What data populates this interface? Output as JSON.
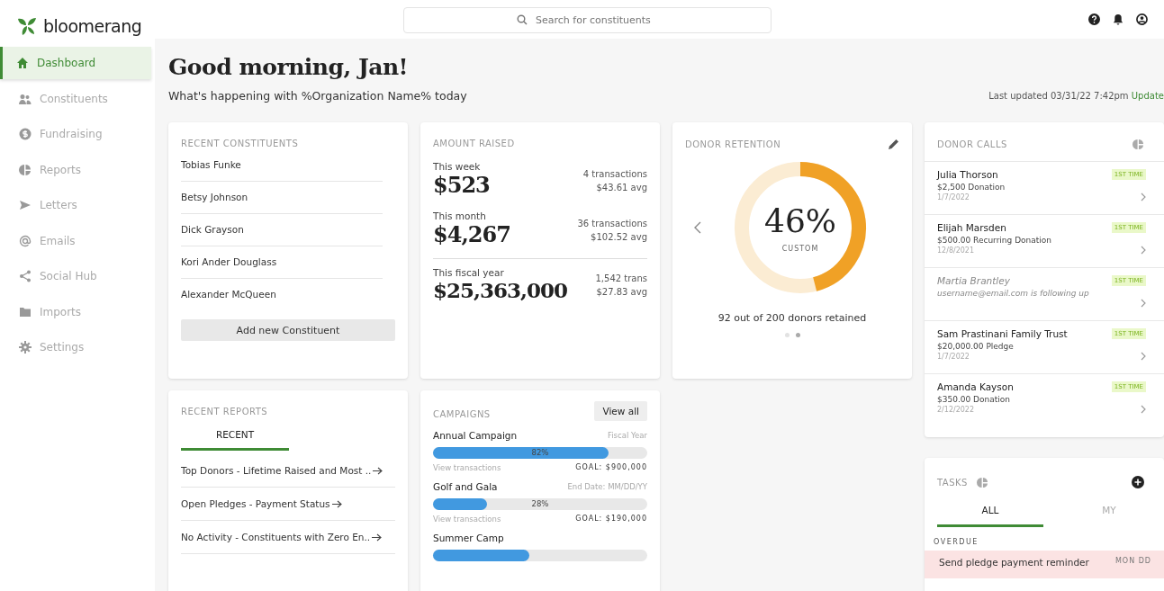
{
  "brand": "bloomerang",
  "search": {
    "placeholder": "Search for constituents"
  },
  "nav": [
    {
      "label": "Dashboard",
      "selected": true
    },
    {
      "label": "Constituents",
      "selected": false
    },
    {
      "label": "Fundraising",
      "selected": false
    },
    {
      "label": "Reports",
      "selected": false
    },
    {
      "label": "Letters",
      "selected": false
    },
    {
      "label": "Emails",
      "selected": false
    },
    {
      "label": "Social Hub",
      "selected": false
    },
    {
      "label": "Imports",
      "selected": false
    },
    {
      "label": "Settings",
      "selected": false
    }
  ],
  "greeting": "Good morning, Jan!",
  "subtitle": "What's happening with %Organization Name% today",
  "last_updated": "Last updated 03/31/22 7:42pm",
  "update_link": "Update",
  "recent_constituents": {
    "title": "RECENT CONSTITUENTS",
    "names": [
      "Tobias Funke",
      "Betsy Johnson",
      "Dick Grayson",
      "Kori Ander Douglass",
      "Alexander McQueen"
    ],
    "button": "Add new Constituent"
  },
  "amount_raised": {
    "title": "AMOUNT RAISED",
    "periods": [
      {
        "label": "This week",
        "amount": "$523",
        "count": "4 transactions",
        "avg": "$43.61 avg"
      },
      {
        "label": "This month",
        "amount": "$4,267",
        "count": "36 transactions",
        "avg": "$102.52 avg"
      },
      {
        "label": "This fiscal year",
        "amount": "$25,363,000",
        "count": "1,542 trans",
        "avg": "$27.83 avg"
      }
    ]
  },
  "donor_retention": {
    "title": "DONOR RETENTION",
    "value": "46%",
    "level": 0.46,
    "caption": "CUSTOM",
    "summary": "92 out of 200 donors retained",
    "pages": [
      {
        "selected": false
      },
      {
        "selected": true
      }
    ]
  },
  "donor_calls": {
    "title": "DONOR CALLS",
    "items": [
      {
        "kind": "call",
        "name": "Julia Thorson",
        "detail": "$2,500 Donation",
        "date": "1/7/2022",
        "badge": "1ST TIME"
      },
      {
        "kind": "call",
        "name": "Elijah Marsden",
        "detail": "$500.00 Recurring Donation",
        "date": "12/8/2021",
        "badge": "1ST TIME"
      },
      {
        "kind": "following",
        "name": "Martia Brantley",
        "detail": "username@email.com is following up",
        "badge": "1ST TIME"
      },
      {
        "kind": "call",
        "name": "Sam Prastinani Family Trust",
        "detail": "$20,000.00 Pledge",
        "date": "1/7/2022",
        "badge": "1ST TIME"
      },
      {
        "kind": "call",
        "name": "Amanda Kayson",
        "detail": "$350.00 Donation",
        "date": "2/12/2022",
        "badge": "1ST TIME"
      }
    ]
  },
  "recent_reports": {
    "title": "RECENT REPORTS",
    "tab": "RECENT",
    "reports": [
      "Top Donors - Lifetime Raised and Most ..",
      "Open Pledges - Payment Status",
      "No Activity - Constituents with Zero En.."
    ]
  },
  "campaigns": {
    "title": "CAMPAIGNS",
    "button": "View all",
    "items": [
      {
        "name": "Annual Campaign",
        "period": "Fiscal Year",
        "level": 0.82,
        "percent": "82%",
        "link": "View transactions",
        "goal": "GOAL: $900,000"
      },
      {
        "name": "Golf and Gala",
        "period": "End Date: MM/DD/YY",
        "level": 0.25,
        "percent": "28%",
        "link": "View transactions",
        "goal": "GOAL: $190,000"
      },
      {
        "name": "Summer Camp",
        "level": 0.45
      }
    ]
  },
  "tasks": {
    "title": "TASKS",
    "tabs": [
      {
        "label": "ALL",
        "selected": true
      },
      {
        "label": "MY",
        "selected": false
      }
    ],
    "section": "OVERDUE",
    "items": [
      {
        "text": "Send pledge payment reminder",
        "due": "MON DD"
      }
    ]
  }
}
